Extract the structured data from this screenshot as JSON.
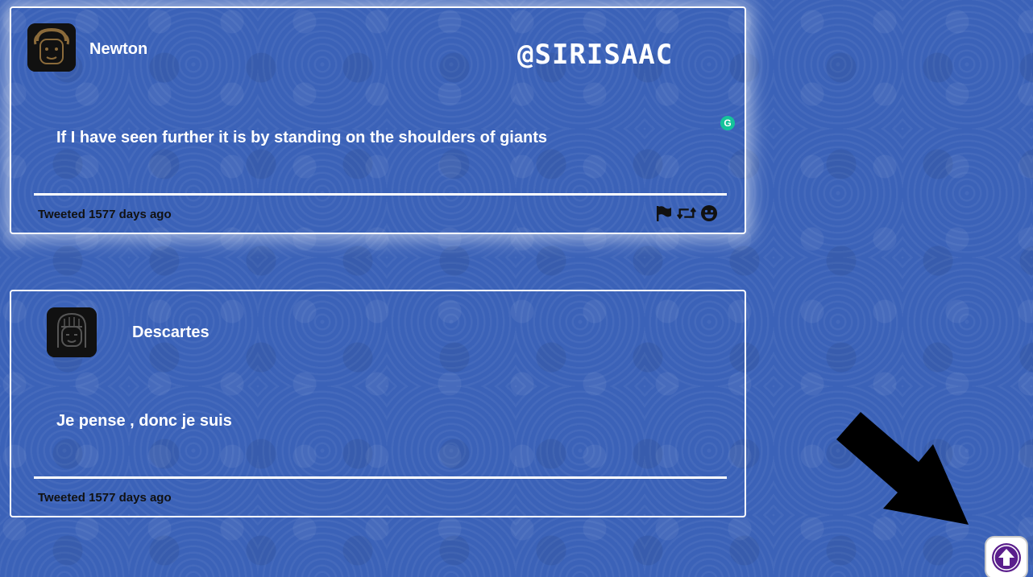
{
  "tweets": [
    {
      "author": "Newton",
      "handle": "@SIRISAAC",
      "text": "If I have seen further it is by standing on the shoulders of giants",
      "timestamp": "Tweeted 1577 days ago",
      "actions": [
        "flag-icon",
        "retweet-icon",
        "emoji-icon"
      ]
    },
    {
      "author": "Descartes",
      "text": "Je pense , donc je suis",
      "timestamp": "Tweeted 1577 days ago"
    }
  ],
  "grammar_badge": "G",
  "colors": {
    "background": "#3b62b8",
    "card_border": "#ffffff",
    "scroll_top_icon": "#5a1e8c",
    "badge": "#15c39a"
  }
}
